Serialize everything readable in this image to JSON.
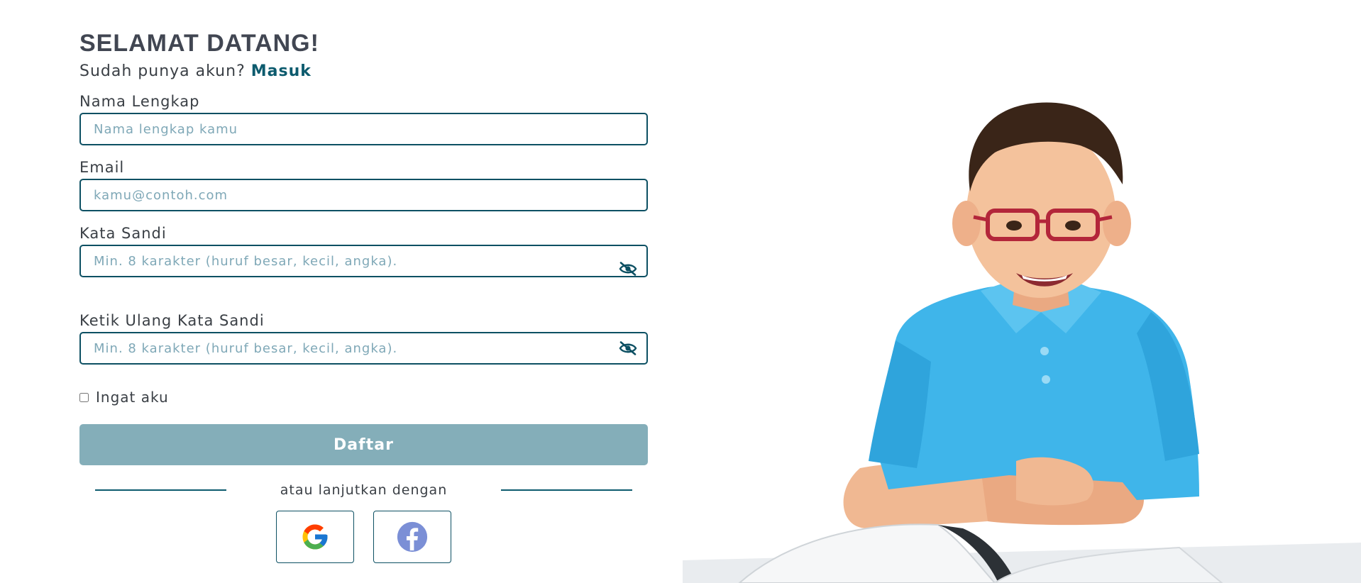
{
  "form": {
    "title": "SELAMAT DATANG!",
    "subtitle_prefix": "Sudah punya akun?",
    "login_link": "Masuk",
    "fields": [
      {
        "label": "Nama Lengkap",
        "placeholder": "Nama lengkap kamu",
        "value": ""
      },
      {
        "label": "Email",
        "placeholder": "kamu@contoh.com",
        "value": ""
      },
      {
        "label": "Kata Sandi",
        "placeholder": "Min. 8 karakter (huruf besar, kecil, angka).",
        "value": "",
        "icon": "eye-slash-icon"
      },
      {
        "label": "Ketik Ulang Kata Sandi",
        "placeholder": "Min. 8 karakter (huruf besar, kecil, angka).",
        "value": "",
        "icon": "eye-slash-icon"
      }
    ],
    "remember_label": "Ingat aku",
    "remember_checked": false,
    "submit_label": "Daftar",
    "divider_text": "atau lanjutkan dengan",
    "social": [
      {
        "provider": "Google",
        "icon": "google-icon"
      },
      {
        "provider": "Facebook",
        "icon": "facebook-icon"
      }
    ]
  },
  "colors": {
    "primary": "#0d5b6e",
    "button": "#84aeb9",
    "placeholder": "#7fa8b7",
    "title": "#414652"
  },
  "image": {
    "description_icon": "boy-with-glasses-illustration"
  }
}
